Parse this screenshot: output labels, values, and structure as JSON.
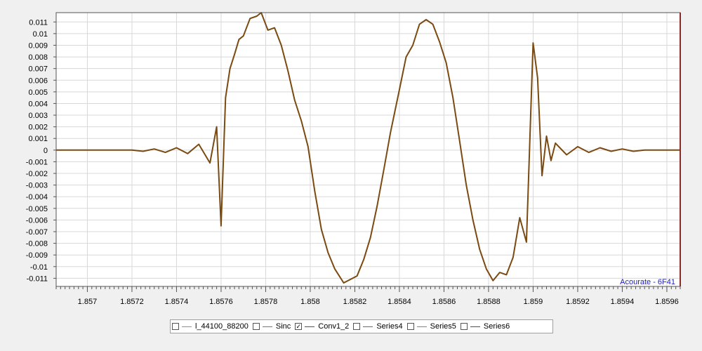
{
  "chart_data": {
    "type": "line",
    "xlim": [
      1.85686,
      1.85966
    ],
    "ylim": [
      -0.0117,
      0.0118
    ],
    "x_ticks": [
      1.857,
      1.8572,
      1.8574,
      1.8576,
      1.8578,
      1.858,
      1.8582,
      1.8584,
      1.8586,
      1.8588,
      1.859,
      1.8592,
      1.8594,
      1.8596
    ],
    "x_tick_labels": [
      "1.857",
      "1.8572",
      "1.8574",
      "1.8576",
      "1.8578",
      "1.858",
      "1.8582",
      "1.8584",
      "1.8586",
      "1.8588",
      "1.859",
      "1.8592",
      "1.8594",
      "1.8596"
    ],
    "y_ticks": [
      0.011,
      0.01,
      0.009,
      0.008,
      0.007,
      0.006,
      0.005,
      0.004,
      0.003,
      0.002,
      0.001,
      0,
      -0.001,
      -0.002,
      -0.003,
      -0.004,
      -0.005,
      -0.006,
      -0.007,
      -0.008,
      -0.009,
      -0.01,
      -0.011
    ],
    "y_tick_labels": [
      "0.011",
      "0.01",
      "0.009",
      "0.008",
      "0.007",
      "0.006",
      "0.005",
      "0.004",
      "0.003",
      "0.002",
      "0.001",
      "0",
      "-0.001",
      "-0.002",
      "-0.003",
      "-0.004",
      "-0.005",
      "-0.006",
      "-0.007",
      "-0.008",
      "-0.009",
      "-0.01",
      "-0.011"
    ],
    "grid": true,
    "legend_position": "bottom-center",
    "annotation": "Acourate - 6F41",
    "series": [
      {
        "name": "Conv1_2",
        "color": "#7a4a10",
        "x": [
          1.85686,
          1.8569,
          1.85695,
          1.857,
          1.85705,
          1.8571,
          1.85715,
          1.8572,
          1.85725,
          1.8573,
          1.85735,
          1.8574,
          1.85745,
          1.8575,
          1.85755,
          1.85758,
          1.8576,
          1.85762,
          1.85764,
          1.85766,
          1.85768,
          1.8577,
          1.85773,
          1.85776,
          1.85778,
          1.85781,
          1.85784,
          1.85787,
          1.8579,
          1.85793,
          1.85796,
          1.85799,
          1.85802,
          1.85805,
          1.85808,
          1.85811,
          1.85815,
          1.85818,
          1.85821,
          1.85824,
          1.85827,
          1.8583,
          1.85833,
          1.85836,
          1.8584,
          1.85843,
          1.85846,
          1.85849,
          1.85852,
          1.85855,
          1.85858,
          1.85861,
          1.85864,
          1.85867,
          1.8587,
          1.85873,
          1.85876,
          1.85879,
          1.85882,
          1.85885,
          1.85888,
          1.85891,
          1.85894,
          1.85897,
          1.859,
          1.85902,
          1.85904,
          1.85906,
          1.85908,
          1.8591,
          1.85915,
          1.8592,
          1.85925,
          1.8593,
          1.85935,
          1.8594,
          1.85945,
          1.8595,
          1.85955,
          1.8596,
          1.85966
        ],
        "y": [
          0,
          0,
          0,
          0,
          0,
          0,
          0,
          0,
          -0.0001,
          0.0001,
          -0.0002,
          0.0002,
          -0.0003,
          0.0005,
          -0.0011,
          0.002,
          -0.0065,
          0.0045,
          0.007,
          0.0082,
          0.0095,
          0.0098,
          0.0113,
          0.0115,
          0.0118,
          0.0103,
          0.0105,
          0.009,
          0.0068,
          0.0043,
          0.0025,
          0.0003,
          -0.0035,
          -0.0068,
          -0.0088,
          -0.0102,
          -0.0114,
          -0.0111,
          -0.0108,
          -0.0094,
          -0.0075,
          -0.0048,
          -0.0017,
          0.0015,
          0.0052,
          0.008,
          0.009,
          0.0108,
          0.0112,
          0.0108,
          0.0093,
          0.0075,
          0.0045,
          0.0008,
          -0.003,
          -0.006,
          -0.0085,
          -0.0102,
          -0.0112,
          -0.0105,
          -0.0107,
          -0.0092,
          -0.0058,
          -0.0079,
          0.0092,
          0.0062,
          -0.0022,
          0.0012,
          -0.0009,
          0.0006,
          -0.0004,
          0.0003,
          -0.0002,
          0.0002,
          -0.0001,
          0.0001,
          -0.0001,
          0,
          0,
          0,
          0
        ]
      }
    ]
  },
  "legend": {
    "items": [
      {
        "name": "l_44100_88200",
        "color": "#ff6060",
        "checked": false,
        "check_text": ""
      },
      {
        "name": "Sinc",
        "color": "#40a040",
        "checked": false,
        "check_text": ""
      },
      {
        "name": "Conv1_2",
        "color": "#7a4a10",
        "checked": true,
        "check_text": "✓"
      },
      {
        "name": "Series4",
        "color": "#4060ff",
        "checked": false,
        "check_text": ""
      },
      {
        "name": "Series5",
        "color": "#40a0a0",
        "checked": false,
        "check_text": ""
      },
      {
        "name": "Series6",
        "color": "#505050",
        "checked": false,
        "check_text": ""
      }
    ]
  }
}
